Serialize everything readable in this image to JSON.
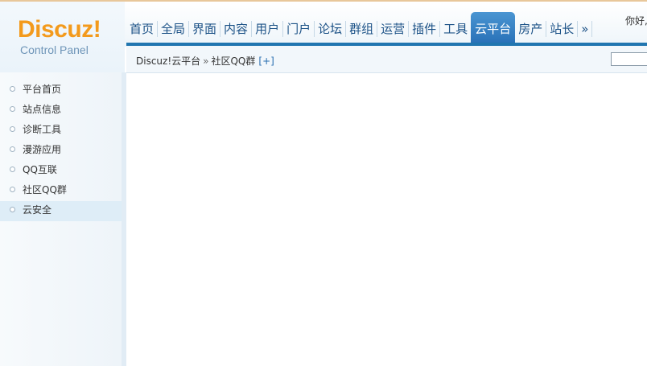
{
  "logo": {
    "main": "Discuz!",
    "sub": "Control Panel"
  },
  "nav": {
    "items": [
      "首页",
      "全局",
      "界面",
      "内容",
      "用户",
      "门户",
      "论坛",
      "群组",
      "运营",
      "插件",
      "工具",
      "云平台",
      "房产",
      "站长",
      "»"
    ],
    "active_index": 11
  },
  "greeting": "你好,",
  "breadcrumb": {
    "root": "Discuz!云平台",
    "separator": "»",
    "current": "社区QQ群",
    "add": "[+]"
  },
  "sidebar": {
    "items": [
      {
        "label": "平台首页"
      },
      {
        "label": "站点信息"
      },
      {
        "label": "诊断工具"
      },
      {
        "label": "漫游应用"
      },
      {
        "label": "QQ互联"
      },
      {
        "label": "社区QQ群"
      },
      {
        "label": "云安全"
      }
    ],
    "active_index": 6
  },
  "colors": {
    "accent": "#2176b0",
    "logo": "#f39a1c",
    "nav_text": "#1c5287"
  }
}
